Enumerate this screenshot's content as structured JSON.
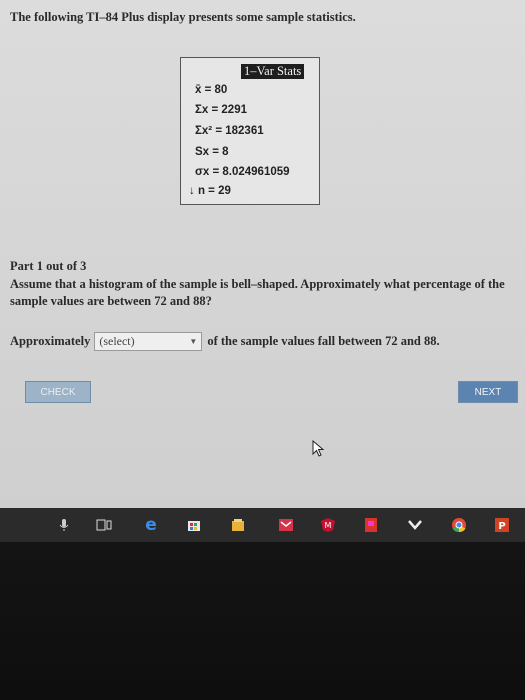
{
  "intro": "The following TI–84 Plus display presents some sample statistics.",
  "calculator": {
    "header": "1–Var Stats",
    "lines": [
      {
        "label": "x̄ = 80"
      },
      {
        "label": "Σx = 2291"
      },
      {
        "label": "Σx² = 182361"
      },
      {
        "label": "Sx = 8"
      },
      {
        "label": "σx = 8.024961059"
      },
      {
        "label": "↓ n = 29"
      }
    ]
  },
  "part": "Part 1 out of 3",
  "question": {
    "line1": "Assume that a histogram of the sample is bell–shaped. Approximately what percentage of the",
    "line2": "sample values are between 72 and 88?"
  },
  "answer": {
    "before": "Approximately",
    "select_value": "(select)",
    "after": "of the sample values fall between 72 and 88."
  },
  "buttons": {
    "check": "CHECK",
    "next": "NEXT"
  },
  "taskbar": {
    "icons": [
      "microphone-icon",
      "task-view-icon",
      "edge-icon",
      "store-icon",
      "files-icon",
      "mail-icon",
      "mcafee-icon",
      "pdf-icon",
      "media-icon",
      "chrome-icon",
      "powerpoint-icon"
    ]
  }
}
